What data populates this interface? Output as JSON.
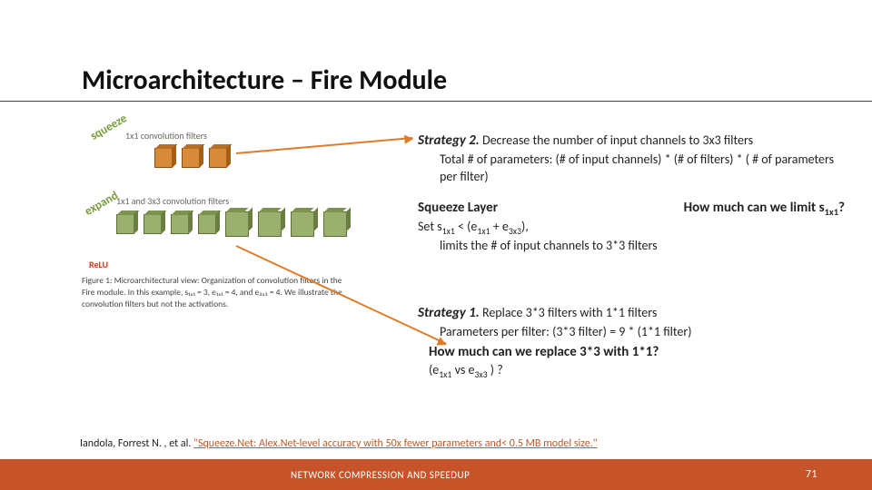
{
  "title": "Microarchitecture – Fire Module",
  "figure": {
    "squeeze_label": "squeeze",
    "expand_label": "expand",
    "convtext1": "1x1 convolution filters",
    "convtext2": "1x1 and 3x3 convolution filters",
    "relu": "ReLU",
    "caption": "Figure 1: Microarchitectural view: Organization of convolution filters in the Fire module. In this example, s₁ₓ₁ = 3, e₁ₓ₁ = 4, and e₃ₓ₃ = 4. We illustrate the convolution filters but not the activations."
  },
  "strategy2": {
    "head": "Strategy 2.",
    "tail": "Decrease the number of input channels to 3x3 filters",
    "sub1": "Total # of parameters: (# of input channels) * (# of filters) * ( # of parameters per filter)"
  },
  "squeeze": {
    "head": "Squeeze Layer",
    "line_a": "Set s",
    "line_a_sub1": "1x1",
    "line_a_mid": " < (e",
    "line_a_sub2": "1x1",
    "line_a_mid2": " + e",
    "line_a_sub3": "3x3",
    "line_a_end": "),",
    "line_b": "limits the # of input channels to 3*3 filters",
    "howmuch_a": "How  much  can  we  limit s",
    "howmuch_sub": "1x1",
    "howmuch_end": "?"
  },
  "strategy1": {
    "head": "Strategy 1.",
    "tail": "Replace  3*3  filters with 1*1 filters",
    "sub1": "Parameters per filter:  (3*3 filter) = 9 * (1*1 filter)",
    "howmuch": "How  much  can  we  replace  3*3  with  1*1?",
    "line_c_a": "(e",
    "line_c_sub1": "1x1",
    "line_c_mid": " vs e",
    "line_c_sub2": "3x3",
    "line_c_end": " ) ?"
  },
  "citation": {
    "authors": "Iandola, Forrest N. , et al. ",
    "link_text": "\"Squeeze.Net: Alex.Net-level accuracy with 50x fewer parameters and< 0.5 MB model size.\""
  },
  "footer": {
    "label": "NETWORK COMPRESSION AND SPEEDUP",
    "page": "71"
  }
}
